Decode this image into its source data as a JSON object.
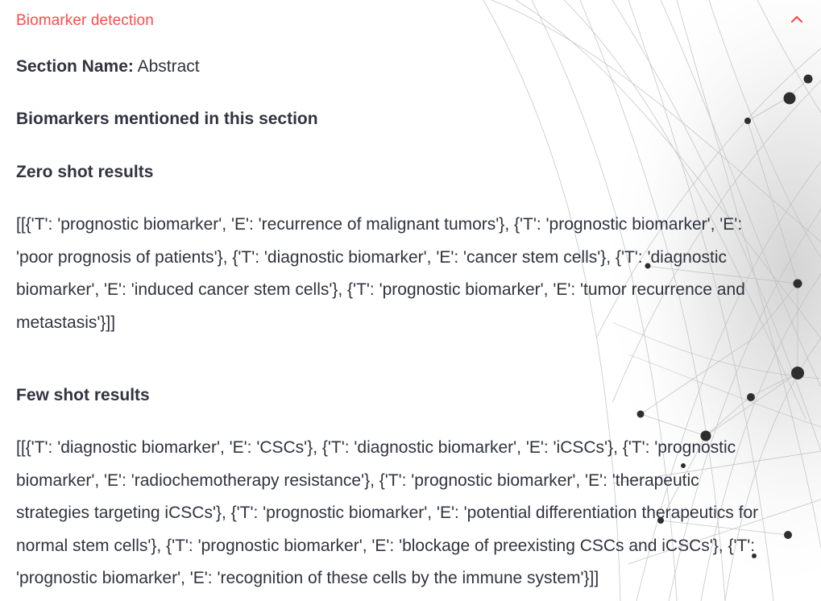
{
  "expander": {
    "title": "Biomarker detection",
    "expanded": true,
    "icon": "chevron-up-icon",
    "accent_color": "#ff4b4b"
  },
  "section": {
    "label": "Section Name:",
    "value": "Abstract"
  },
  "biomarkers_heading": "Biomarkers mentioned in this section",
  "zero_shot": {
    "heading": "Zero shot results",
    "lines": [
      "[[{'T': 'prognostic biomarker', 'E': 'recurrence of malignant tumors'}, {'T': 'prognostic biomarker', 'E':",
      "'poor prognosis of patients'}, {'T': 'diagnostic biomarker', 'E': 'cancer stem cells'}, {'T': 'diagnostic",
      "biomarker', 'E': 'induced cancer stem cells'}, {'T': 'prognostic biomarker', 'E': 'tumor recurrence and",
      "metastasis'}]]"
    ]
  },
  "few_shot": {
    "heading": "Few shot results",
    "lines": [
      "[[{'T': 'diagnostic biomarker', 'E': 'CSCs'}, {'T': 'diagnostic biomarker', 'E': 'iCSCs'}, {'T': 'prognostic",
      "biomarker', 'E': 'radiochemotherapy resistance'}, {'T': 'prognostic biomarker', 'E': 'therapeutic",
      "strategies targeting iCSCs'}, {'T': 'prognostic biomarker', 'E': 'potential differentiation therapeutics for",
      "normal stem cells'}, {'T': 'prognostic biomarker', 'E': 'blockage of preexisting CSCs and iCSCs'}, {'T':",
      "'prognostic biomarker', 'E': 'recognition of these cells by the immune system'}]]"
    ]
  }
}
